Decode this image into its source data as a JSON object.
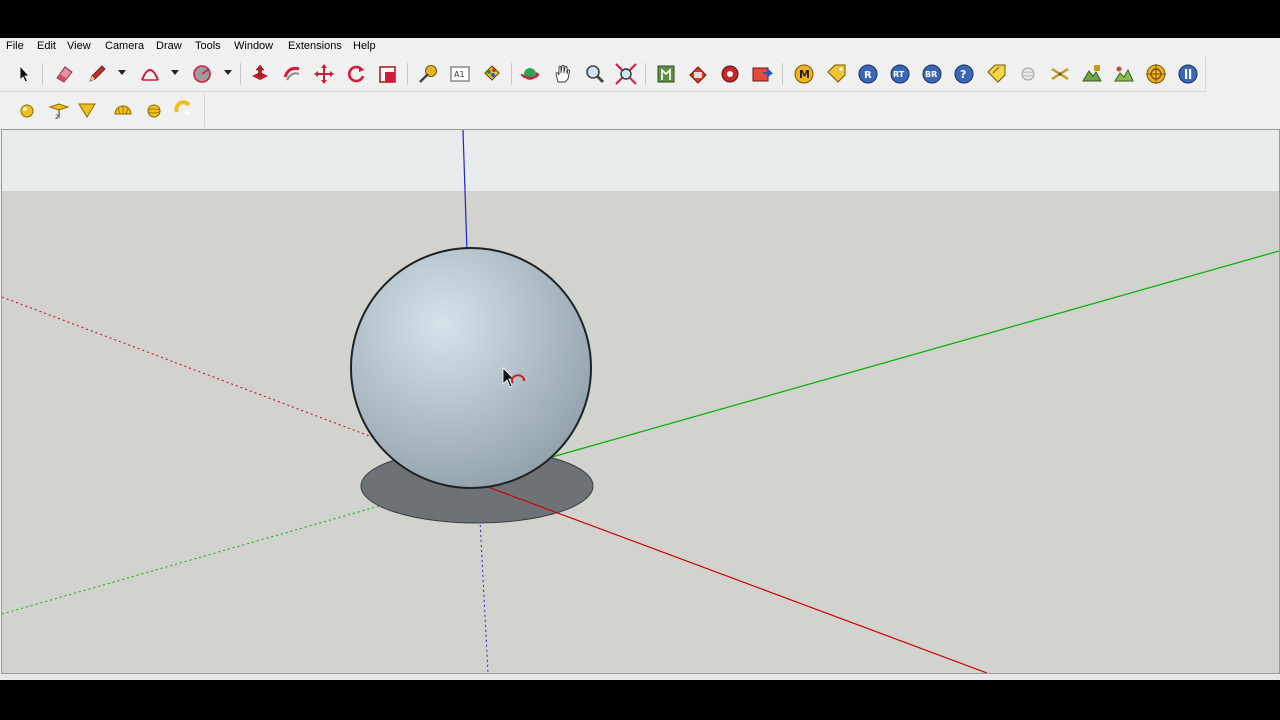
{
  "menu": {
    "file": "File",
    "edit": "Edit",
    "view": "View",
    "camera": "Camera",
    "draw": "Draw",
    "tools": "Tools",
    "window": "Window",
    "extensions": "Extensions",
    "help": "Help"
  },
  "toolbar_icons": {
    "badge_m": "M",
    "badge_r": "R",
    "badge_rt": "RT",
    "badge_br": "BR",
    "badge_help": "?",
    "dimension_label": "A1"
  },
  "colors": {
    "red_axis": "#cc0000",
    "green_axis": "#00b000",
    "blue_axis": "#2020e0",
    "sky": "#e9ecec",
    "ground": "#d2d3ce",
    "sphere_light": "#d6e3ea",
    "sphere_dark": "#8f9fa9",
    "shadow": "#6c7275"
  }
}
